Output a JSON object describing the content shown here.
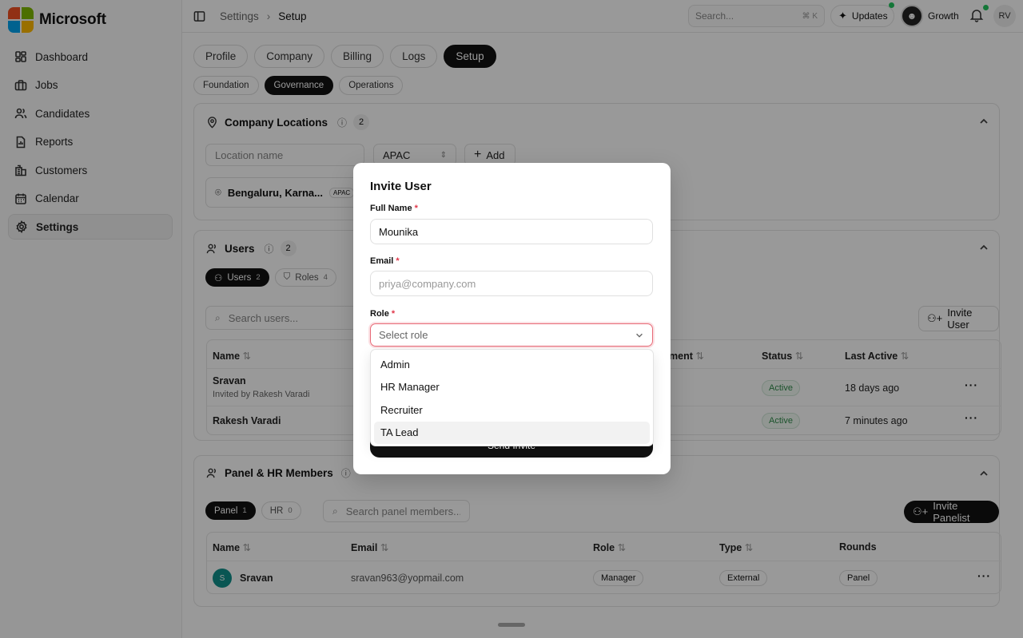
{
  "brand": {
    "name": "Microsoft"
  },
  "sidebar": {
    "items": [
      {
        "label": "Dashboard",
        "icon": "dashboard-icon"
      },
      {
        "label": "Jobs",
        "icon": "briefcase-icon"
      },
      {
        "label": "Candidates",
        "icon": "users-icon"
      },
      {
        "label": "Reports",
        "icon": "report-icon"
      },
      {
        "label": "Customers",
        "icon": "building-icon"
      },
      {
        "label": "Calendar",
        "icon": "calendar-icon"
      },
      {
        "label": "Settings",
        "icon": "gear-icon",
        "active": true
      }
    ]
  },
  "topbar": {
    "breadcrumb": [
      "Settings",
      "Setup"
    ],
    "search_placeholder": "Search...",
    "search_shortcut": "⌘ K",
    "updates_label": "Updates",
    "workspace_label": "Growth",
    "user_initials": "RV"
  },
  "tabs": [
    "Profile",
    "Company",
    "Billing",
    "Logs",
    "Setup"
  ],
  "active_tab": "Setup",
  "subtabs": [
    "Foundation",
    "Governance",
    "Operations"
  ],
  "active_subtab": "Governance",
  "locations": {
    "title": "Company Locations",
    "count": "2",
    "name_placeholder": "Location name",
    "region_value": "APAC",
    "add_label": "Add",
    "item_label": "Bengaluru, Karna...",
    "item_region": "APAC"
  },
  "users": {
    "title": "Users",
    "count": "2",
    "seg_users": "Users",
    "seg_users_count": "2",
    "seg_roles": "Roles",
    "seg_roles_count": "4",
    "search_placeholder": "Search users...",
    "invite_label": "Invite User",
    "columns": {
      "name": "Name",
      "department": "ment",
      "status": "Status",
      "last_active": "Last Active"
    },
    "rows": [
      {
        "name": "Sravan",
        "sub": "Invited by Rakesh Varadi",
        "status": "Active",
        "last_active": "18 days ago"
      },
      {
        "name": "Rakesh Varadi",
        "sub": "",
        "status": "Active",
        "last_active": "7 minutes ago"
      }
    ]
  },
  "panel": {
    "title": "Panel & HR Members",
    "seg_panel": "Panel",
    "seg_panel_count": "1",
    "seg_hr": "HR",
    "seg_hr_count": "0",
    "search_placeholder": "Search panel members...",
    "invite_label": "Invite Panelist",
    "columns": {
      "name": "Name",
      "email": "Email",
      "role": "Role",
      "type": "Type",
      "rounds": "Rounds"
    },
    "rows": [
      {
        "initial": "S",
        "name": "Sravan",
        "email": "sravan963@yopmail.com",
        "role": "Manager",
        "type": "External",
        "rounds": "Panel"
      }
    ]
  },
  "modal": {
    "title": "Invite User",
    "full_name_label": "Full Name",
    "full_name_value": "Mounika",
    "email_label": "Email",
    "email_placeholder": "priya@company.com",
    "role_label": "Role",
    "role_placeholder": "Select role",
    "required_mark": "*",
    "send_label": "Send Invite",
    "role_options": [
      "Admin",
      "HR Manager",
      "Recruiter",
      "TA Lead"
    ],
    "highlighted_option": "TA Lead"
  },
  "colors": {
    "accent": "#111111",
    "required": "#e0374a",
    "active_status": "#2f8a4a",
    "online_dot": "#22c55e"
  }
}
